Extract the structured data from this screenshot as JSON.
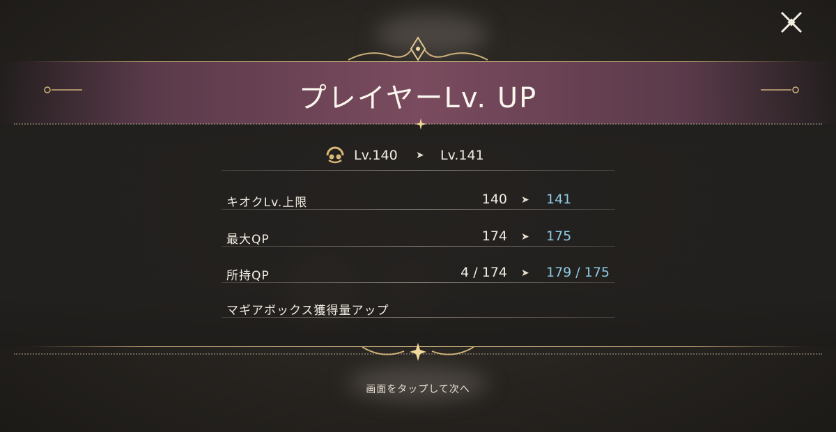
{
  "dialog": {
    "title": "プレイヤーLv. UP",
    "level_from": "Lv.140",
    "level_to": "Lv.141"
  },
  "stats": [
    {
      "label": "キオクLv.上限",
      "old": "140",
      "new": "141"
    },
    {
      "label": "最大QP",
      "old": "174",
      "new": "175"
    },
    {
      "label": "所持QP",
      "old": "4 / 174",
      "new": "179 / 175"
    },
    {
      "label": "マギアボックス獲得量アップ",
      "old": "",
      "new": ""
    }
  ],
  "footer": {
    "hint": "画面をタップして次へ"
  },
  "colors": {
    "accent_gold": "#d8bf8a",
    "band": "#7a4b5e",
    "new_value": "#8fcbe6"
  },
  "icons": {
    "close": "close-x-icon",
    "player": "player-face-icon",
    "arrow": "right-arrow-icon"
  }
}
